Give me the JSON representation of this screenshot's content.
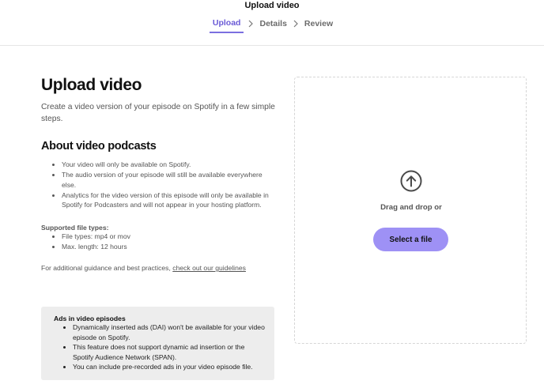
{
  "header": {
    "title": "Upload video",
    "steps": [
      {
        "label": "Upload",
        "active": true
      },
      {
        "label": "Details",
        "active": false
      },
      {
        "label": "Review",
        "active": false
      }
    ]
  },
  "main": {
    "heading": "Upload video",
    "intro": "Create a video version of your episode on Spotify in a few simple steps.",
    "about_heading": "About video podcasts",
    "about_items": [
      "Your video will only be available on Spotify.",
      "The audio version of your episode will still be available everywhere else.",
      "Analytics for the video version of this episode will only be available in Spotify for Podcasters and will not appear in your hosting platform."
    ],
    "file_types_title": "Supported file types:",
    "file_types": [
      "File types: mp4 or mov",
      "Max. length: 12 hours"
    ],
    "guidance_text": "For additional guidance and best practices,",
    "guidance_link": "check out our guidelines",
    "ads": {
      "title": "Ads in video episodes",
      "items": [
        "Dynamically inserted ads (DAI) won't be available for your video episode on Spotify.",
        "This feature does not support dynamic ad insertion or the Spotify Audience Network (SPAN).",
        "You can include pre-recorded ads in your video episode file."
      ]
    }
  },
  "dropzone": {
    "icon": "upload-arrow-icon",
    "text": "Drag and drop or",
    "button_label": "Select a file"
  },
  "colors": {
    "accent": "#6a5ad6",
    "button": "#9e91f5",
    "notice_bg": "#ededed"
  }
}
